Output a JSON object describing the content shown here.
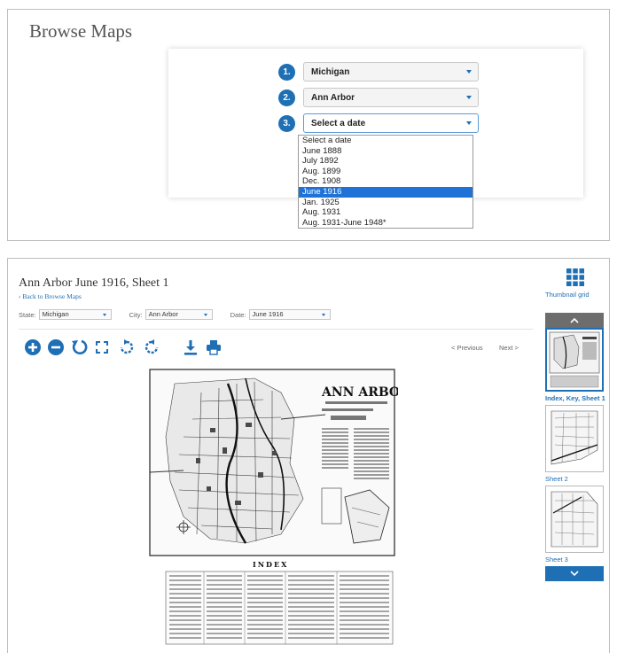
{
  "browse": {
    "title": "Browse Maps",
    "steps": [
      {
        "number": "1.",
        "value": "Michigan"
      },
      {
        "number": "2.",
        "value": "Ann Arbor"
      },
      {
        "number": "3.",
        "value": "Select a date"
      }
    ],
    "date_options": [
      "Select a date",
      "June 1888",
      "July 1892",
      "Aug. 1899",
      "Dec. 1908",
      "June 1916",
      "Jan. 1925",
      "Aug. 1931",
      "Aug. 1931-June 1948*"
    ],
    "highlighted_option": "June 1916"
  },
  "viewer": {
    "title": "Ann Arbor June 1916, Sheet 1",
    "back_link": "Back to Browse Maps",
    "filters": {
      "state_label": "State:",
      "state_value": "Michigan",
      "city_label": "City:",
      "city_value": "Ann Arbor",
      "date_label": "Date:",
      "date_value": "June 1916"
    },
    "toolbar_icons": [
      "zoom-in-icon",
      "zoom-out-icon",
      "reset-icon",
      "fullscreen-icon",
      "rotate-left-icon",
      "rotate-right-icon",
      "download-icon",
      "print-icon"
    ],
    "previous_label": "< Previous",
    "next_label": "Next >",
    "map_heading": "ANN ARBOR",
    "index_heading": "INDEX",
    "thumbnail_grid_label": "Thumbnail grid",
    "thumbnails": [
      {
        "label": "Index, Key, Sheet 1",
        "active": true
      },
      {
        "label": "Sheet 2",
        "active": false
      },
      {
        "label": "Sheet 3",
        "active": false
      }
    ]
  },
  "colors": {
    "accent": "#1f6fb5",
    "highlight": "#1f73d6",
    "scroll_up": "#6d6d6d"
  }
}
